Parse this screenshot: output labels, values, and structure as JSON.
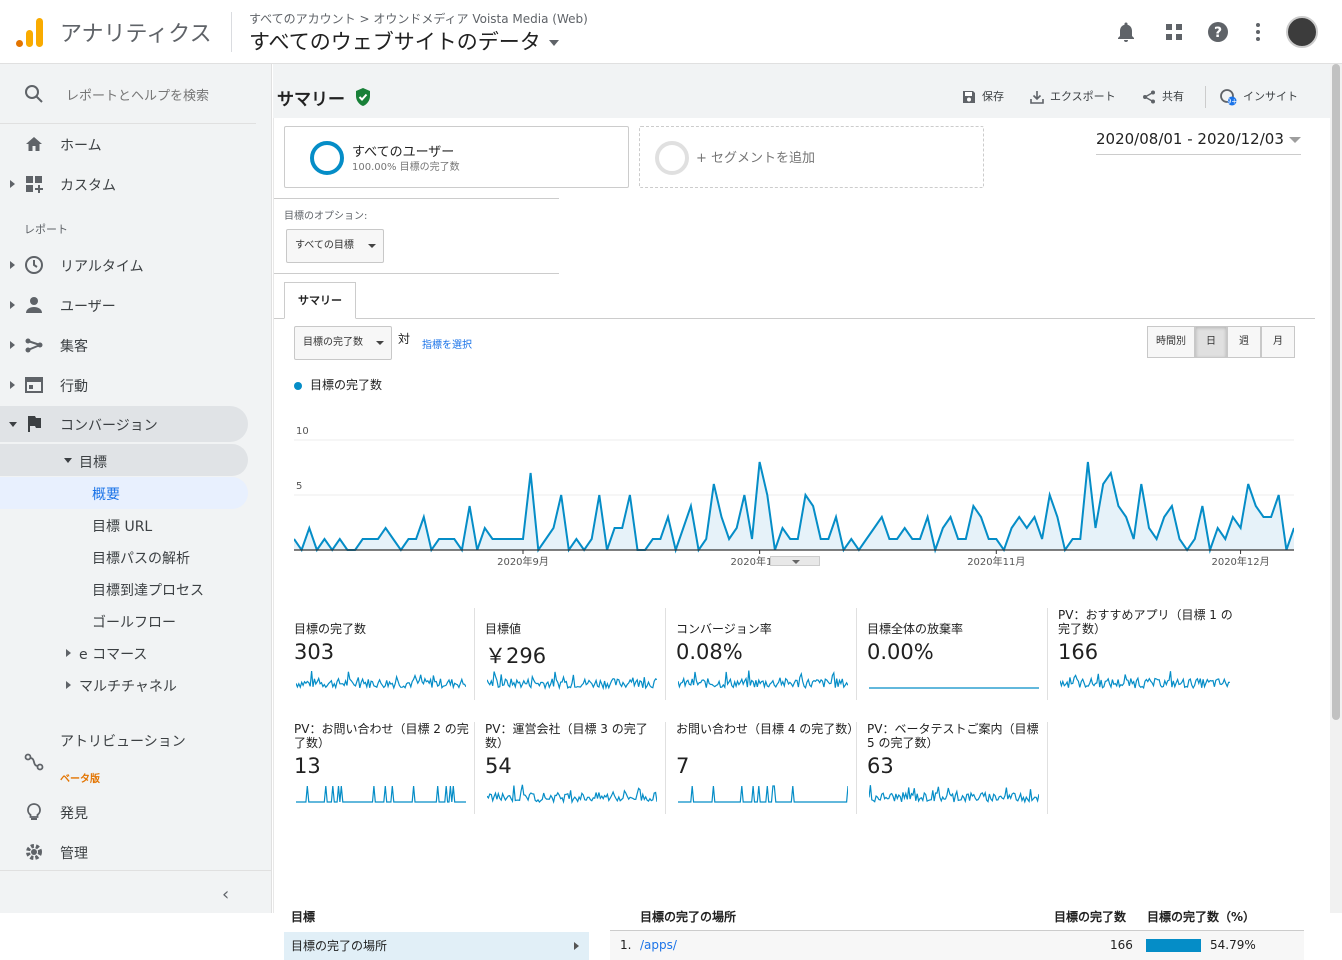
{
  "header": {
    "app_name": "アナリティクス",
    "breadcrumb": "すべてのアカウント > オウンドメディア Voista Media (Web)",
    "property_title": "すべてのウェブサイトのデータ"
  },
  "sidebar": {
    "search_placeholder": "レポートとヘルプを検索",
    "home": "ホーム",
    "custom": "カスタム",
    "reports_label": "レポート",
    "realtime": "リアルタイム",
    "users": "ユーザー",
    "acquisition": "集客",
    "behavior": "行動",
    "conversions": "コンバージョン",
    "goals": "目標",
    "overview": "概要",
    "goal_url": "目標 URL",
    "reverse_path": "目標パスの解析",
    "funnel": "目標到達プロセス",
    "goal_flow": "ゴールフロー",
    "ecommerce": "e コマース",
    "multichannel": "マルチチャネル",
    "attribution": "アトリビューション",
    "beta": "ベータ版",
    "discover": "発見",
    "admin": "管理"
  },
  "toolbar": {
    "title": "サマリー",
    "save": "保存",
    "export": "エクスポート",
    "share": "共有",
    "insights": "インサイト"
  },
  "segments": {
    "all_users": "すべてのユーザー",
    "all_users_sub": "100.00% 目標の完了数",
    "add_segment": "+ セグメントを追加"
  },
  "date_range": "2020/08/01 - 2020/12/03",
  "goal_options": {
    "label": "目標のオプション:",
    "selected": "すべての目標"
  },
  "tab": "サマリー",
  "metric_select": "目標の完了数",
  "vs": "対",
  "pick_metric": "指標を選択",
  "periods": [
    "時間別",
    "日",
    "週",
    "月"
  ],
  "legend": "目標の完了数",
  "accent": "#058dc7",
  "chart_data": {
    "type": "area",
    "series_name": "目標の完了数",
    "yticks": [
      "10",
      "5"
    ],
    "ylim": [
      0,
      10
    ],
    "xticks": [
      "2020年9月",
      "2020年10月",
      "2020年11月",
      "2020年12月"
    ],
    "values": [
      1,
      0,
      2,
      0,
      1,
      0,
      1,
      0,
      0,
      1,
      1,
      1,
      2,
      1,
      0,
      1,
      1,
      3,
      0,
      1,
      1,
      1,
      0,
      4,
      0,
      2,
      1,
      1,
      1,
      1,
      1,
      7,
      0,
      1,
      2,
      5,
      0,
      1,
      0,
      1,
      5,
      0,
      2,
      2,
      5,
      0,
      0,
      1,
      1,
      3,
      0,
      2,
      4,
      0,
      1,
      6,
      3,
      1,
      2,
      5,
      1,
      8,
      5,
      0,
      2,
      1,
      1,
      5,
      4,
      1,
      1,
      3,
      0,
      1,
      0,
      1,
      2,
      3,
      1,
      1,
      2,
      1,
      1,
      3,
      0,
      2,
      3,
      1,
      1,
      4,
      3,
      1,
      1,
      0,
      2,
      3,
      2,
      3,
      1,
      5,
      3,
      0,
      1,
      1,
      8,
      2,
      6,
      7,
      4,
      3,
      1,
      6,
      2,
      1,
      3,
      4,
      1,
      0,
      1,
      4,
      0,
      2,
      1,
      3,
      2,
      6,
      4,
      3,
      3,
      5,
      0,
      2
    ]
  },
  "tiles": [
    {
      "label": "目標の完了数",
      "value": "303"
    },
    {
      "label": "目標値",
      "value": "￥296"
    },
    {
      "label": "コンバージョン率",
      "value": "0.08%"
    },
    {
      "label": "目標全体の放棄率",
      "value": "0.00%"
    },
    {
      "label": "PV：おすすめアプリ（目標 1 の完了数）",
      "value": "166"
    },
    {
      "label": "PV：お問い合わせ（目標 2 の完了数）",
      "value": "13"
    },
    {
      "label": "PV：運営会社（目標 3 の完了数）",
      "value": "54"
    },
    {
      "label": "お問い合わせ（目標 4 の完了数）",
      "value": "7"
    },
    {
      "label": "PV：ベータテストご案内（目標 5 の完了数）",
      "value": "63"
    }
  ],
  "goal_table": {
    "left_header": "目標",
    "left_row": "目標の完了の場所",
    "col_location": "目標の完了の場所",
    "col_completions": "目標の完了数",
    "col_pct": "目標の完了数（%）",
    "row_index": "1.",
    "row_path": "/apps/",
    "row_completions": "166",
    "row_pct": "54.79%",
    "row_fraction": 0.5479
  }
}
